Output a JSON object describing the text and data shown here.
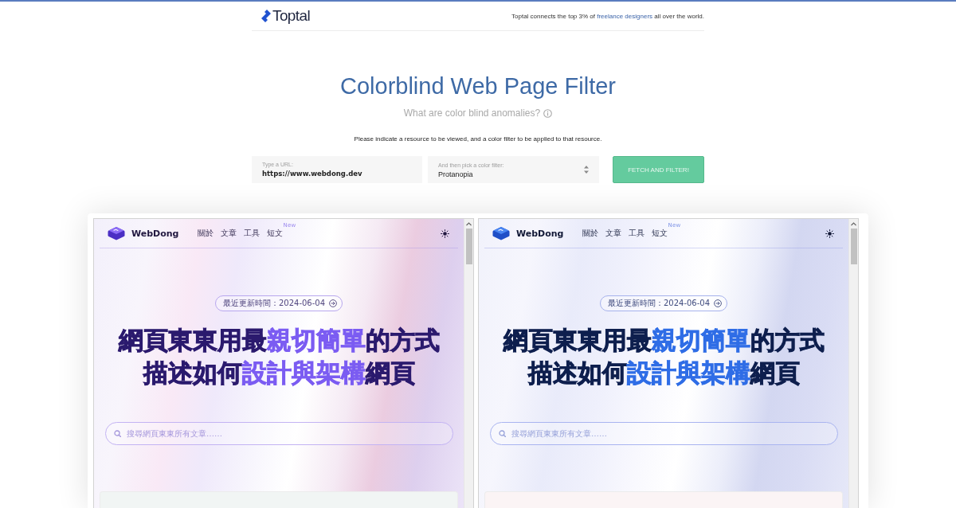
{
  "header": {
    "logo": "Toptal",
    "tagline": {
      "text": "Toptal connects the top 3% of",
      "link": "freelance designers",
      "text_end": "all over the world."
    }
  },
  "hero": {
    "title": "Colorblind Web Page Filter",
    "subtitle": "What are color blind anomalies?",
    "instructions": "Please indicate a resource to be viewed, and a color filter to be applied to that resource."
  },
  "form": {
    "url_field": {
      "label": "Type a URL:",
      "value": "https://www.webdong.dev"
    },
    "filter_select": {
      "label": "And then pick a color filter:",
      "value": "Protanopia"
    },
    "submit_button": "FETCH AND FILTER!"
  },
  "previews": [
    {
      "kind": "original",
      "brand": "WebDong",
      "nav": [
        {
          "label": "關於"
        },
        {
          "label": "文章"
        },
        {
          "label": "工具"
        },
        {
          "label": "短文",
          "badge": "New"
        }
      ],
      "updated": "最近更新時間：2024-06-04",
      "headline": [
        "網頁東東用最**親切簡單**的方式",
        "描述如何**設計與架構**網頁"
      ],
      "search_placeholder": "搜尋網頁東東所有文章……"
    },
    {
      "kind": "filtered",
      "brand": "WebDong",
      "nav": [
        {
          "label": "關於"
        },
        {
          "label": "文章"
        },
        {
          "label": "工具"
        },
        {
          "label": "短文",
          "badge": "New"
        }
      ],
      "updated": "最近更新時間：2024-06-04",
      "headline": [
        "網頁東東用最**親切簡單**的方式",
        "描述如何**設計與架構**網頁"
      ],
      "search_placeholder": "搜尋網頁東東所有文章……"
    }
  ]
}
